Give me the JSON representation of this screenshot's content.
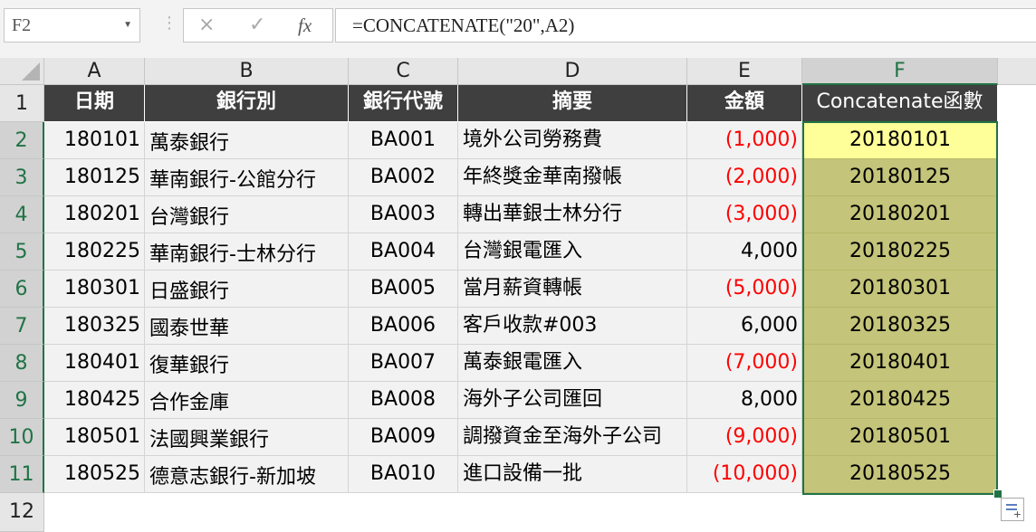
{
  "name_box": "F2",
  "formula": "=CONCATENATE(\"20\",A2)",
  "formula_icons": {
    "cancel": "×",
    "enter": "✓",
    "fx": "fx"
  },
  "columns": [
    "A",
    "B",
    "C",
    "D",
    "E",
    "F"
  ],
  "selected_column": "F",
  "rows": [
    "1",
    "2",
    "3",
    "4",
    "5",
    "6",
    "7",
    "8",
    "9",
    "10",
    "11",
    "12"
  ],
  "headers": [
    "日期",
    "銀行別",
    "銀行代號",
    "摘要",
    "金額",
    "Concatenate函數"
  ],
  "data": [
    {
      "date": "180101",
      "bank": "萬泰銀行",
      "code": "BA001",
      "desc": "境外公司勞務費",
      "amount": "(1,000)",
      "neg": true,
      "result": "20180101"
    },
    {
      "date": "180125",
      "bank": "華南銀行-公館分行",
      "code": "BA002",
      "desc": "年終獎金華南撥帳",
      "amount": "(2,000)",
      "neg": true,
      "result": "20180125"
    },
    {
      "date": "180201",
      "bank": "台灣銀行",
      "code": "BA003",
      "desc": "轉出華銀士林分行",
      "amount": "(3,000)",
      "neg": true,
      "result": "20180201"
    },
    {
      "date": "180225",
      "bank": "華南銀行-士林分行",
      "code": "BA004",
      "desc": "台灣銀電匯入",
      "amount": "4,000",
      "neg": false,
      "result": "20180225"
    },
    {
      "date": "180301",
      "bank": "日盛銀行",
      "code": "BA005",
      "desc": "當月薪資轉帳",
      "amount": "(5,000)",
      "neg": true,
      "result": "20180301"
    },
    {
      "date": "180325",
      "bank": "國泰世華",
      "code": "BA006",
      "desc": "客戶收款#003",
      "amount": "6,000",
      "neg": false,
      "result": "20180325"
    },
    {
      "date": "180401",
      "bank": "復華銀行",
      "code": "BA007",
      "desc": "萬泰銀電匯入",
      "amount": "(7,000)",
      "neg": true,
      "result": "20180401"
    },
    {
      "date": "180425",
      "bank": "合作金庫",
      "code": "BA008",
      "desc": "海外子公司匯回",
      "amount": "8,000",
      "neg": false,
      "result": "20180425"
    },
    {
      "date": "180501",
      "bank": "法國興業銀行",
      "code": "BA009",
      "desc": "調撥資金至海外子公司",
      "amount": "(9,000)",
      "neg": true,
      "result": "20180501"
    },
    {
      "date": "180525",
      "bank": "德意志銀行-新加坡",
      "code": "BA010",
      "desc": "進口設備一批",
      "amount": "(10,000)",
      "neg": true,
      "result": "20180525"
    }
  ],
  "colors": {
    "header_bg": "#3f3f3f",
    "negative": "#ff0000",
    "highlight": "#c4c47a",
    "active_cell": "#ffff99",
    "selection": "#217346"
  }
}
